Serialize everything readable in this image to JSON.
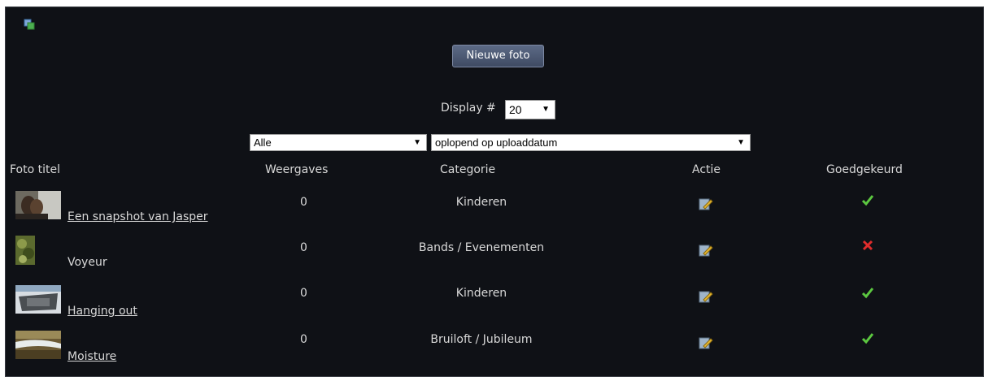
{
  "toolbar": {
    "new_photo_label": "Nieuwe foto"
  },
  "display": {
    "label": "Display #",
    "count_value": "20"
  },
  "filters": {
    "category_value": "Alle",
    "sort_value": "oplopend op uploaddatum"
  },
  "table": {
    "headers": {
      "title": "Foto titel",
      "views": "Weergaves",
      "category": "Categorie",
      "action": "Actie",
      "approved": "Goedgekeurd"
    },
    "rows": [
      {
        "title": "Een snapshot van Jasper",
        "views": "0",
        "category": "Kinderen",
        "approved": true
      },
      {
        "title": "Voyeur",
        "views": "0",
        "category": "Bands / Evenementen",
        "approved": false
      },
      {
        "title": "Hanging out",
        "views": "0",
        "category": "Kinderen",
        "approved": true
      },
      {
        "title": "Moisture",
        "views": "0",
        "category": "Bruiloft / Jubileum",
        "approved": true
      }
    ]
  },
  "icons": {
    "corner": "copy-icon",
    "action": "edit-icon",
    "approved": "check-icon",
    "rejected": "cross-icon"
  },
  "colors": {
    "panel_bg": "#0f1116",
    "button_bg": "#4e5a74",
    "check": "#5cc840",
    "cross": "#e02c2c"
  }
}
